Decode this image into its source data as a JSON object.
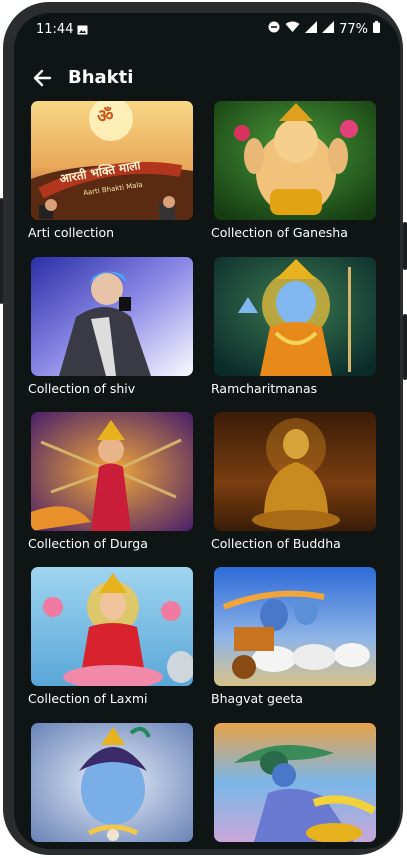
{
  "status_bar": {
    "time": "11:44",
    "battery": "77%",
    "icons": [
      "gallery-icon",
      "dnd-icon",
      "wifi-icon",
      "signal-icon",
      "signal-icon",
      "battery-icon"
    ]
  },
  "app_bar": {
    "title": "Bhakti",
    "back_icon": "back-arrow-icon"
  },
  "collections": [
    {
      "label": "Arti collection"
    },
    {
      "label": "Collection of Ganesha"
    },
    {
      "label": "Collection of shiv"
    },
    {
      "label": "Ramcharitmanas"
    },
    {
      "label": "Collection of Durga"
    },
    {
      "label": "Collection of Buddha"
    },
    {
      "label": "Collection of Laxmi"
    },
    {
      "label": "Bhagvat geeta"
    },
    {
      "label": ""
    },
    {
      "label": ""
    }
  ],
  "thumbnail_text": {
    "arti_symbol": "ॐ",
    "arti_title": "आरती भक्ति माला",
    "arti_subtitle": "Aarti Bhakti Mala"
  }
}
